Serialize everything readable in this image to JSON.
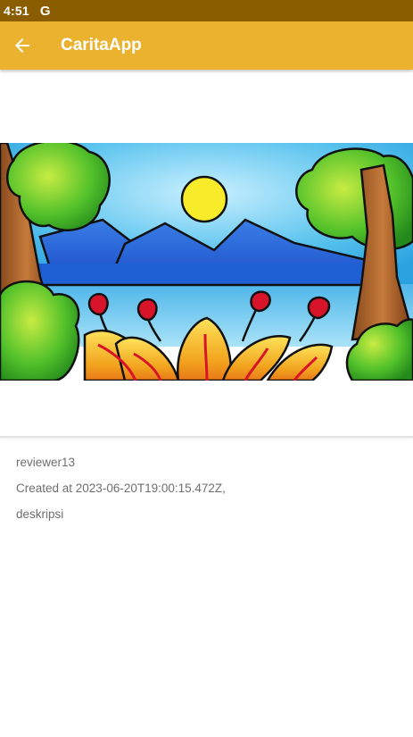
{
  "status_bar": {
    "time": "4:51",
    "notification_icon": "G"
  },
  "app_bar": {
    "back_icon": "arrow-back-icon",
    "title": "CaritaApp",
    "background_color": "#ebb22f"
  },
  "post": {
    "image_description_icon": "landscape-drawing",
    "author": "reviewer13",
    "created_at": "Created at 2023-06-20T19:00:15.472Z,",
    "description": "deskripsi"
  }
}
